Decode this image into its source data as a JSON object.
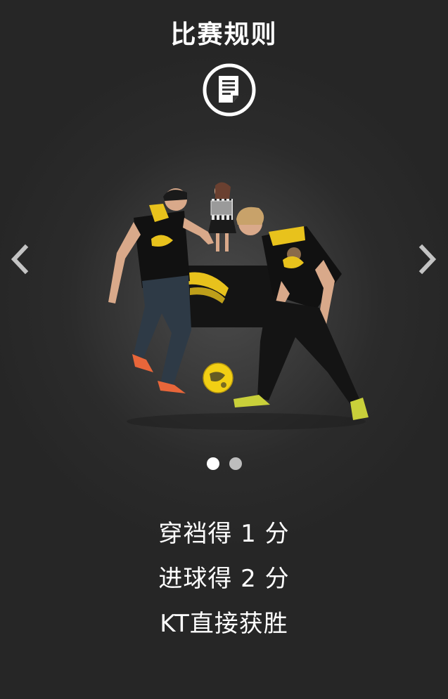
{
  "header": {
    "title": "比赛规则",
    "icon": "document-icon"
  },
  "carousel": {
    "prev_icon": "chevron-left-icon",
    "next_icon": "chevron-right-icon",
    "slide_count": 2,
    "active_index": 0,
    "arrow_color": "#bdbdbd"
  },
  "rules": [
    "穿裆得 1 分",
    "进球得 2 分",
    "KT直接获胜"
  ],
  "colors": {
    "background": "#2b2b2b",
    "text": "#ffffff",
    "accent_yellow": "#e8c21c"
  }
}
